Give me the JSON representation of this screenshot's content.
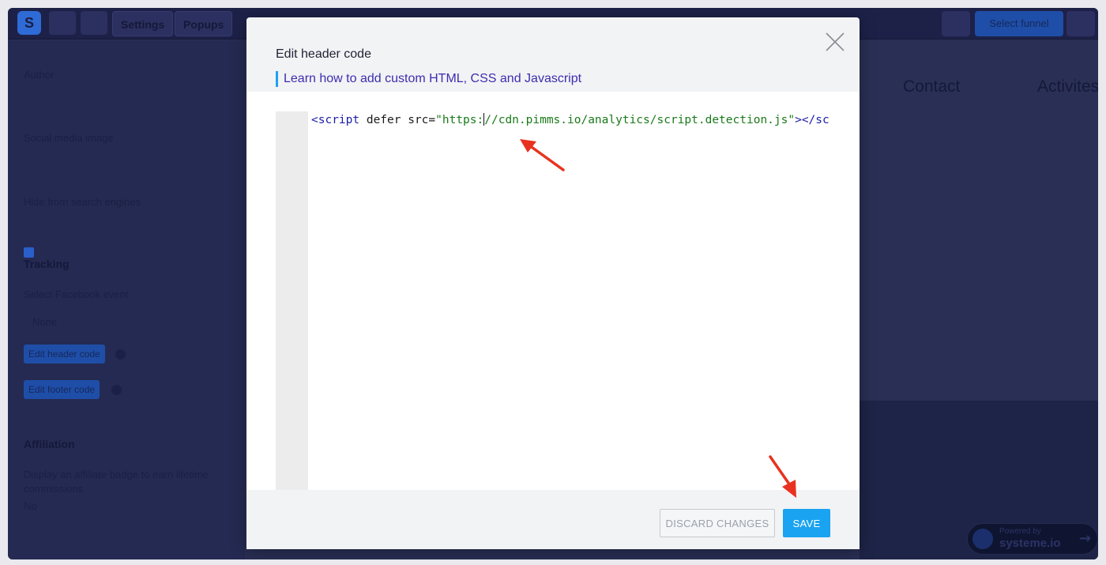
{
  "app": {
    "logo_letter": "S",
    "toolbar": {
      "settings_label": "Settings",
      "popups_label": "Popups",
      "select_label": "Select funnel"
    }
  },
  "sidebar": {
    "author_label": "Author",
    "social_image_label": "Social media image",
    "hide_label": "Hide from search engines",
    "tracking_heading": "Tracking",
    "fb_event_label": "Select Facebook event",
    "fb_event_value": "None",
    "edit_header_btn": "Edit header code",
    "edit_footer_btn": "Edit footer code",
    "affiliation_heading": "Affiliation",
    "affiliate_text": "Display an affiliate badge to earn lifetime commissions",
    "affiliate_value": "No"
  },
  "background_nav": {
    "contact": "Contact",
    "activities": "Activites"
  },
  "powered": {
    "small": "Powered by",
    "brand": "systeme.io"
  },
  "modal": {
    "title": "Edit header code",
    "help_link": "Learn how to add custom HTML, CSS and Javascript",
    "code": {
      "open_tag": "<script",
      "attr": " defer src=",
      "str_before_cursor": "\"https:",
      "str_after_cursor": "//cdn.pimms.io/analytics/script.detection.js\"",
      "close_tag": "></scrip"
    },
    "discard_label": "DISCARD CHANGES",
    "save_label": "SAVE",
    "close_icon": "close-icon"
  },
  "colors": {
    "save": "#1aa3f0",
    "link_bar": "#1da1f2",
    "annotation": "#e8321f"
  }
}
